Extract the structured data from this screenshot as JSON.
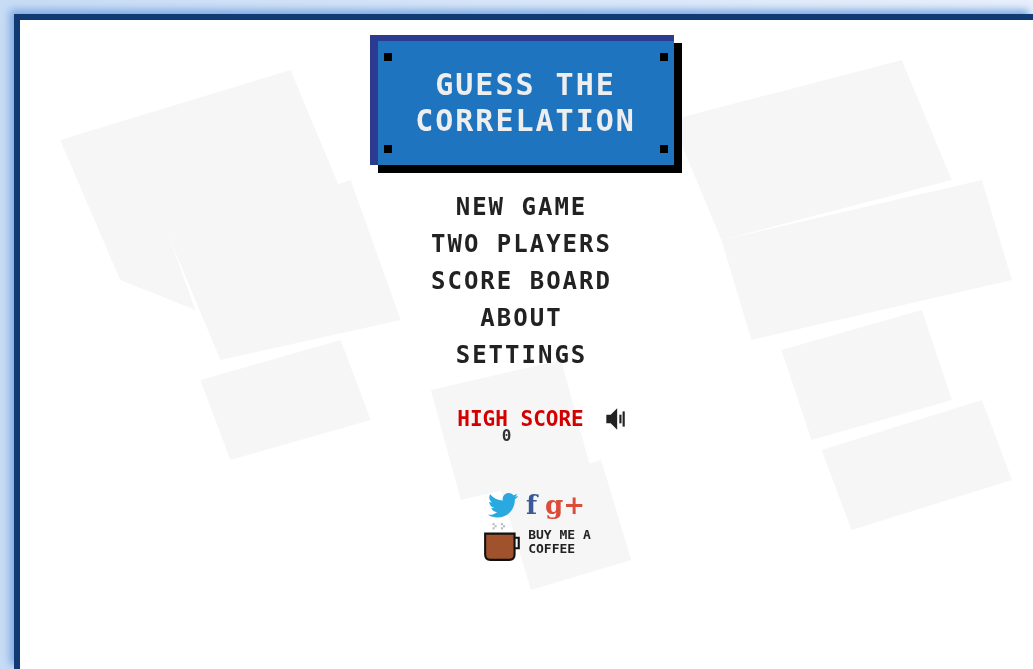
{
  "title": {
    "lines": [
      "GUESS THE",
      "CORRELATION"
    ]
  },
  "menu": [
    {
      "label": "NEW GAME"
    },
    {
      "label": "TWO PLAYERS"
    },
    {
      "label": "SCORE BOARD"
    },
    {
      "label": "ABOUT"
    },
    {
      "label": "SETTINGS"
    }
  ],
  "high_score": {
    "label": "HIGH SCORE",
    "value": "0",
    "sound_on": true
  },
  "social": [
    {
      "kind": "twitter"
    },
    {
      "kind": "text",
      "text": "f",
      "color": "#3b5998"
    },
    {
      "kind": "text",
      "text": "g+",
      "color": "#dd4b39"
    }
  ],
  "coffee": {
    "lines": [
      "BUY ME A",
      "COFFEE"
    ]
  }
}
